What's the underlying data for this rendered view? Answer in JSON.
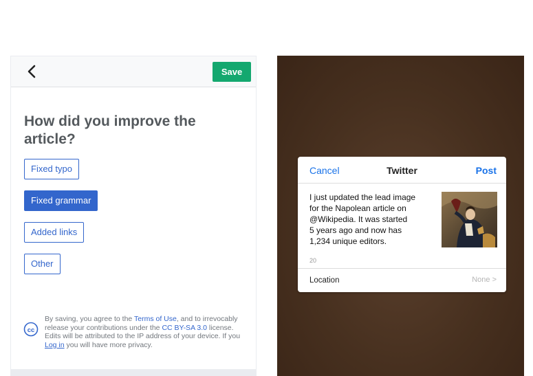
{
  "edit_summary": {
    "save_label": "Save",
    "question": "How did you improve the article?",
    "choices": [
      {
        "label": "Fixed typo",
        "selected": false
      },
      {
        "label": "Fixed grammar",
        "selected": true
      },
      {
        "label": "Added links",
        "selected": false
      },
      {
        "label": "Other",
        "selected": false
      }
    ],
    "license": {
      "prefix": "By saving, you agree to the ",
      "terms_link": "Terms of Use",
      "middle": ", and to irrevocably release your contributions under the ",
      "cc_link": "CC BY-SA 3.0",
      "suffix": " license.",
      "ip_prefix": "Edits will be attributed to the IP address of your device. If you ",
      "login_link": "Log in",
      "ip_suffix": " you will have more privacy."
    },
    "accent_color": "#3366cc",
    "save_color": "#14a86f"
  },
  "twitter_share": {
    "cancel_label": "Cancel",
    "title": "Twitter",
    "post_label": "Post",
    "tweet_text": "I just updated the lead image\nfor the Napolean article on\n@Wikipedia. It was started\n5 years ago and now has\n1,234 unique editors.",
    "char_count": "20",
    "location_label": "Location",
    "location_value": "None  >",
    "link_color": "#1a73e8"
  }
}
